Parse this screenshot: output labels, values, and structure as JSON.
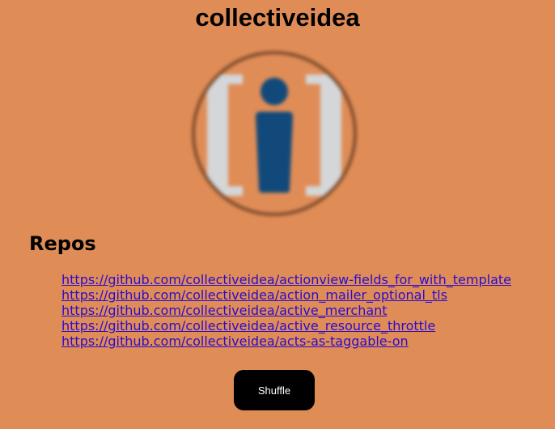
{
  "header": {
    "title": "collectiveidea"
  },
  "avatar": {
    "icon": "collectiveidea-logo-icon",
    "colors": {
      "ring": "#7a4a2c",
      "background": "#e08c56",
      "bracket": "#d4d6d8",
      "figure": "#114a7a"
    }
  },
  "repos": {
    "heading": "Repos",
    "items": [
      {
        "label": "https://github.com/collectiveidea/actionview-fields_for_with_template"
      },
      {
        "label": "https://github.com/collectiveidea/action_mailer_optional_tls"
      },
      {
        "label": "https://github.com/collectiveidea/active_merchant"
      },
      {
        "label": "https://github.com/collectiveidea/active_resource_throttle"
      },
      {
        "label": "https://github.com/collectiveidea/acts-as-taggable-on"
      }
    ]
  },
  "actions": {
    "shuffle_label": "Shuffle"
  },
  "theme": {
    "page_background": "#e08c56",
    "link_color": "#2a0cd0",
    "button_background": "#000000",
    "button_text": "#ffffff"
  }
}
